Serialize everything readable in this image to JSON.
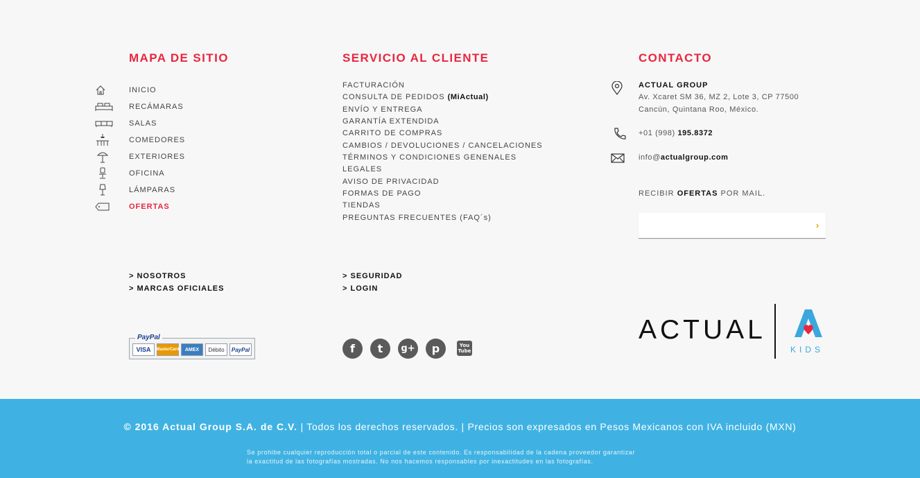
{
  "sitemap": {
    "heading": "MAPA DE SITIO",
    "items": [
      {
        "label": "INICIO",
        "icon": "home-icon"
      },
      {
        "label": "RECÁMARAS",
        "icon": "bed-icon"
      },
      {
        "label": "SALAS",
        "icon": "sofa-icon"
      },
      {
        "label": "COMEDORES",
        "icon": "dining-table-icon"
      },
      {
        "label": "EXTERIORES",
        "icon": "parasol-icon"
      },
      {
        "label": "OFICINA",
        "icon": "office-chair-icon"
      },
      {
        "label": "LÁMPARAS",
        "icon": "lamp-icon"
      },
      {
        "label": "OFERTAS",
        "icon": "price-tag-icon"
      }
    ]
  },
  "service": {
    "heading": "SERVICIO AL CLIENTE",
    "items": [
      "FACTURACIÓN",
      "CONSULTA DE PEDIDOS",
      "ENVÍO Y ENTREGA",
      "GARANTÍA EXTENDIDA",
      "CARRITO DE COMPRAS",
      "CAMBIOS / DEVOLUCIONES / CANCELACIONES",
      "TÉRMINOS Y CONDICIONES GENENALES",
      "LEGALES",
      "AVISO DE PRIVACIDAD",
      "FORMAS DE PAGO",
      "TIENDAS",
      "PREGUNTAS FRECUENTES (FAQ´s)"
    ],
    "miactual": "(MiActual)"
  },
  "contact": {
    "heading": "CONTACTO",
    "company": "ACTUAL GROUP",
    "address_line1": "Av. Xcaret SM 36, MZ 2, Lote 3, CP 77500",
    "address_line2": "Cancún, Quintana Roo, México.",
    "phone_prefix": "+01 (998)",
    "phone_number": "195.8372",
    "email_user": "info@",
    "email_domain": "actualgroup.com",
    "newsletter_pre": "RECIBIR",
    "newsletter_bold": "OFERTAS",
    "newsletter_post": "POR MAIL.",
    "newsletter_placeholder": "",
    "submit_symbol": "›"
  },
  "links": {
    "nosotros": "> NOSOTROS",
    "marcas": "> MARCAS OFICIALES",
    "seguridad": "> SEGURIDAD",
    "login": "> LOGIN"
  },
  "payments": {
    "label": "PayPal",
    "cards": [
      "VISA",
      "MasterCard",
      "AMEX",
      "Débito",
      "PayPal"
    ]
  },
  "social": [
    {
      "name": "facebook-icon",
      "glyph": "f"
    },
    {
      "name": "twitter-icon",
      "glyph": "t"
    },
    {
      "name": "google-plus-icon",
      "glyph": "g+"
    },
    {
      "name": "pinterest-icon",
      "glyph": "p"
    },
    {
      "name": "youtube-icon",
      "glyph": "You Tube"
    }
  ],
  "logo": {
    "word": "ACTUAL",
    "kids": "KIDS",
    "brand_color": "#3aa8dd",
    "accent_heart": "#e8263f"
  },
  "footer": {
    "company": "© 2016 Actual Group S.A. de C.V.",
    "rights": " | Todos los derechos reservados. | Precios son expresados en Pesos Mexicanos con IVA incluido (MXN)",
    "disclaimer_line1": "Se prohibe cualquier reproducción total o parcial de este contenido. Es responsabilidad de la cadena proveedor garantizar",
    "disclaimer_line2": "la exactitud de las fotografías mostradas. No nos hacemos responsables por inexactitudes en las fotografías.",
    "bg_color": "#3fb2e3"
  },
  "colors": {
    "accent": "#e8263f",
    "background": "#f7f7f7"
  }
}
